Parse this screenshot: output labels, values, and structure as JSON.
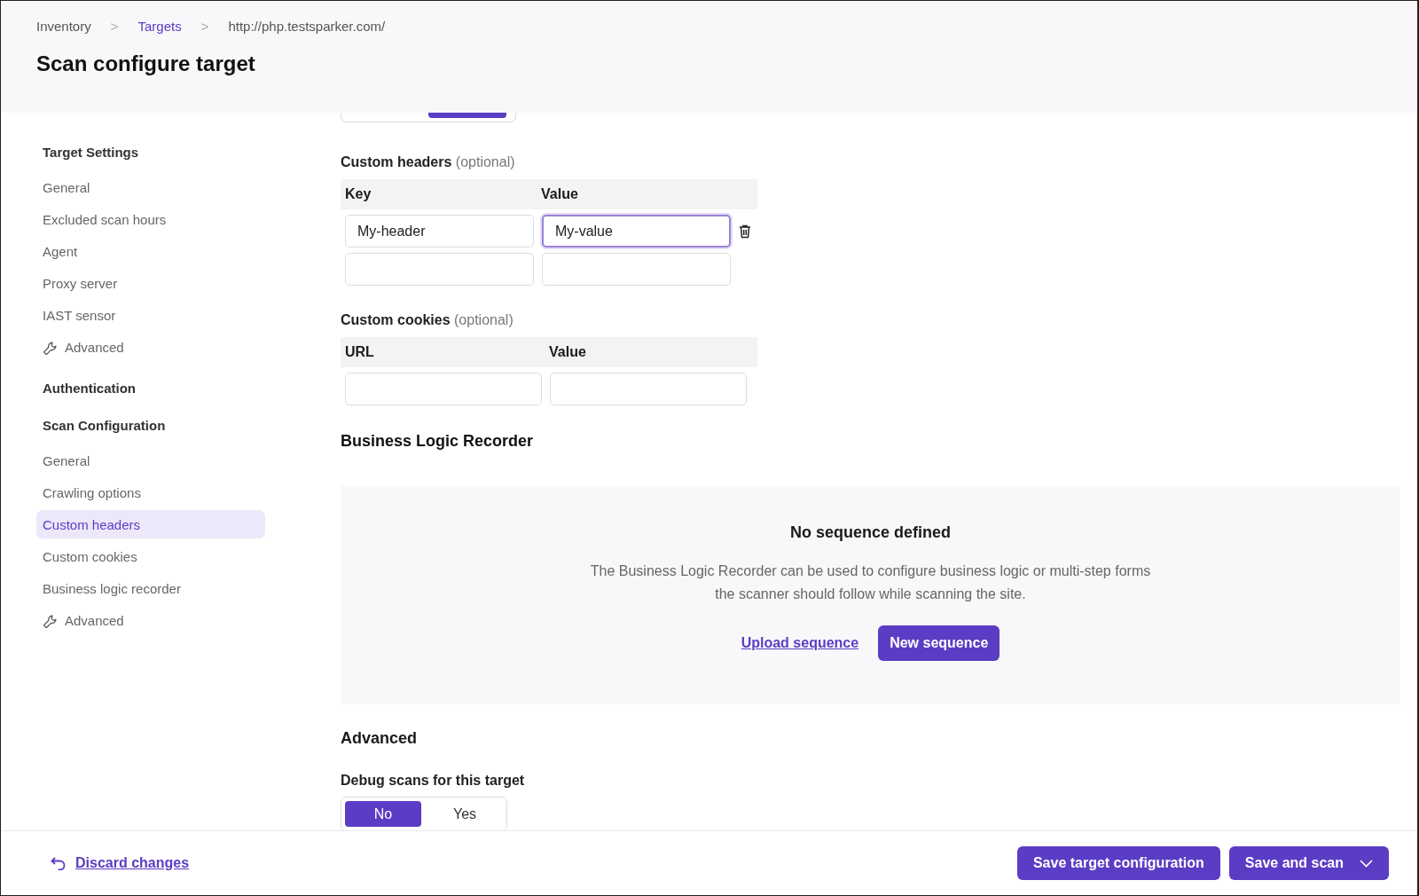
{
  "breadcrumb": [
    {
      "kind": "text",
      "label": "Inventory"
    },
    {
      "kind": "separator",
      "label": ">"
    },
    {
      "kind": "link",
      "label": "Targets"
    },
    {
      "kind": "separator",
      "label": ">"
    },
    {
      "kind": "text",
      "label": "http://php.testsparker.com/"
    }
  ],
  "page_title": "Scan configure target",
  "sidebar": {
    "sections": [
      {
        "title": "Target Settings",
        "items": [
          {
            "label": "General",
            "selected": false,
            "kind": "plain"
          },
          {
            "label": "Excluded scan hours",
            "selected": false,
            "kind": "plain"
          },
          {
            "label": "Agent",
            "selected": false,
            "kind": "plain"
          },
          {
            "label": "Proxy server",
            "selected": false,
            "kind": "plain"
          },
          {
            "label": "IAST sensor",
            "selected": false,
            "kind": "plain"
          },
          {
            "label": "Advanced",
            "selected": false,
            "kind": "tool"
          }
        ]
      },
      {
        "title": "Authentication"
      },
      {
        "title": "Scan Configuration",
        "items": [
          {
            "label": "General",
            "selected": false,
            "kind": "plain"
          },
          {
            "label": "Crawling options",
            "selected": false,
            "kind": "plain"
          },
          {
            "label": "Custom headers",
            "selected": true,
            "kind": "plain"
          },
          {
            "label": "Custom cookies",
            "selected": false,
            "kind": "plain"
          },
          {
            "label": "Business logic recorder",
            "selected": false,
            "kind": "plain"
          },
          {
            "label": "Advanced",
            "selected": false,
            "kind": "tool"
          }
        ]
      }
    ]
  },
  "top_toggle": {
    "options": [
      {
        "selected": false
      },
      {
        "selected": true
      }
    ]
  },
  "custom_headers": {
    "title": "Custom headers",
    "hint": "(optional)",
    "columns": [
      "Key",
      "Value"
    ],
    "rows": [
      {
        "deletable": true,
        "cells": [
          {
            "value": "My-header",
            "focused": false
          },
          {
            "value": "My-value",
            "focused": true
          }
        ]
      },
      {
        "deletable": false,
        "cells": [
          {
            "focused": false
          },
          {
            "focused": false
          }
        ]
      }
    ]
  },
  "custom_cookies": {
    "title": "Custom cookies",
    "hint": "(optional)",
    "columns": [
      "URL",
      "Value"
    ],
    "rows": [
      {
        "deletable": false,
        "cells": [
          {
            "focused": false
          },
          {
            "focused": false
          }
        ]
      }
    ]
  },
  "business_logic": {
    "title": "Business Logic Recorder",
    "empty_title": "No sequence defined",
    "description_lines": [
      "The Business Logic Recorder can be used to configure business logic or multi-step forms",
      "the scanner should follow while scanning the site."
    ],
    "upload_link": "Upload sequence",
    "new_button": "New sequence"
  },
  "advanced": {
    "title": "Advanced",
    "debug_label": "Debug scans for this target",
    "options": [
      {
        "label": "No",
        "selected": true
      },
      {
        "label": "Yes",
        "selected": false
      }
    ]
  },
  "footer": {
    "discard": "Discard changes",
    "buttons": [
      {
        "kind": "plain",
        "label": "Save target configuration"
      },
      {
        "kind": "dropdown",
        "label": "Save and scan"
      }
    ]
  }
}
